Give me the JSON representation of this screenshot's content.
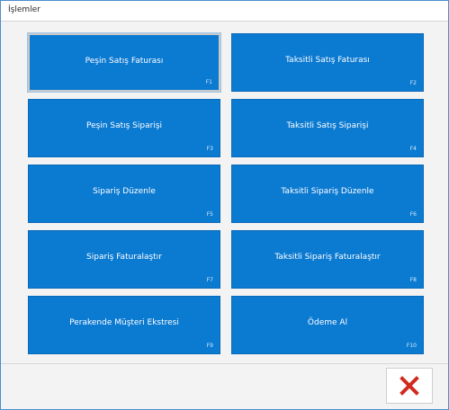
{
  "window": {
    "title": "İşlemler"
  },
  "operations": [
    {
      "label": "Peşin Satış Faturası",
      "key": "F1",
      "selected": true
    },
    {
      "label": "Taksitli Satış Faturası",
      "key": "F2"
    },
    {
      "label": "Peşin Satış Siparişi",
      "key": "F3"
    },
    {
      "label": "Taksitli Satış Siparişi",
      "key": "F4"
    },
    {
      "label": "Sipariş Düzenle",
      "key": "F5"
    },
    {
      "label": "Taksitli Sipariş Düzenle",
      "key": "F6"
    },
    {
      "label": "Sipariş Faturalaştır",
      "key": "F7"
    },
    {
      "label": "Taksitli Sipariş Faturalaştır",
      "key": "F8"
    },
    {
      "label": "Perakende Müşteri Ekstresi",
      "key": "F9"
    },
    {
      "label": "Ödeme Al",
      "key": "F10"
    }
  ],
  "footer": {
    "close_icon": "close-icon"
  },
  "colors": {
    "button_bg": "#0b7ad1",
    "close_icon": "#d12b1f"
  }
}
